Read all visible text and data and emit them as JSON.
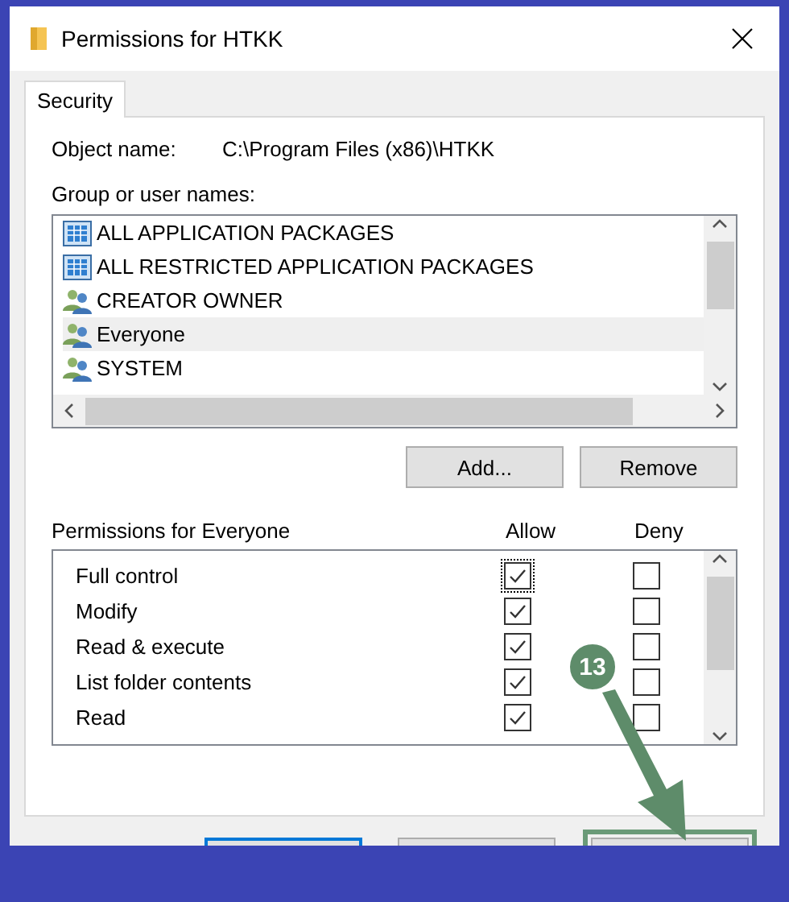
{
  "window": {
    "title": "Permissions for HTKK"
  },
  "tabs": [
    {
      "label": "Security",
      "selected": true
    }
  ],
  "object_name": {
    "label": "Object name:",
    "value": "C:\\Program Files (x86)\\HTKK"
  },
  "groups_label": "Group or user names:",
  "groups": [
    {
      "name": "ALL APPLICATION PACKAGES",
      "kind": "package",
      "selected": false
    },
    {
      "name": "ALL RESTRICTED APPLICATION PACKAGES",
      "kind": "package",
      "selected": false
    },
    {
      "name": "CREATOR OWNER",
      "kind": "group",
      "selected": false
    },
    {
      "name": "Everyone",
      "kind": "group",
      "selected": true
    },
    {
      "name": "SYSTEM",
      "kind": "group",
      "selected": false
    }
  ],
  "group_buttons": [
    "Add...",
    "Remove"
  ],
  "permissions": {
    "title": "Permissions for Everyone",
    "columns": [
      "Allow",
      "Deny"
    ],
    "rows": [
      {
        "name": "Full control",
        "allow": true,
        "deny": false,
        "focused": true
      },
      {
        "name": "Modify",
        "allow": true,
        "deny": false,
        "focused": false
      },
      {
        "name": "Read & execute",
        "allow": true,
        "deny": false,
        "focused": false
      },
      {
        "name": "List folder contents",
        "allow": true,
        "deny": false,
        "focused": false
      },
      {
        "name": "Read",
        "allow": true,
        "deny": false,
        "focused": false
      }
    ]
  },
  "step_marker": {
    "label": "13"
  },
  "buttons": [
    {
      "default": true,
      "highlighted": false
    },
    {
      "default": false,
      "highlighted": false
    },
    {
      "default": false,
      "highlighted": true
    }
  ]
}
